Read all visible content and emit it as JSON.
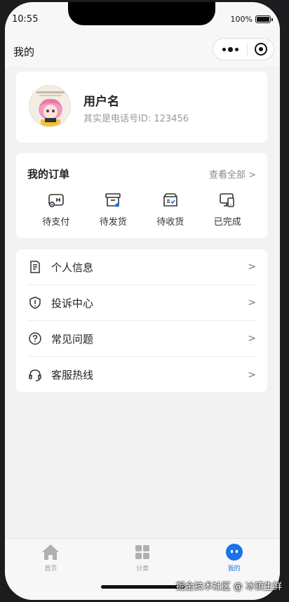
{
  "status_bar": {
    "time": "10:55",
    "battery": "100%"
  },
  "nav": {
    "title": "我的"
  },
  "user": {
    "name": "用户名",
    "subtitle": "其实是电话号ID: 123456"
  },
  "orders": {
    "title": "我的订单",
    "view_all": "查看全部 >",
    "items": [
      {
        "label": "待支付",
        "icon": "wallet-icon"
      },
      {
        "label": "待发货",
        "icon": "box-icon"
      },
      {
        "label": "待收货",
        "icon": "receive-box-icon"
      },
      {
        "label": "已完成",
        "icon": "devices-icon"
      }
    ]
  },
  "menu": {
    "items": [
      {
        "label": "个人信息",
        "icon": "document-icon"
      },
      {
        "label": "投诉中心",
        "icon": "shield-icon"
      },
      {
        "label": "常见问题",
        "icon": "question-icon"
      },
      {
        "label": "客服热线",
        "icon": "headset-icon"
      }
    ],
    "arrow": ">"
  },
  "tabs": [
    {
      "label": "首页",
      "icon": "home-icon",
      "active": false
    },
    {
      "label": "分类",
      "icon": "grid-icon",
      "active": false
    },
    {
      "label": "我的",
      "icon": "profile-icon",
      "active": true
    }
  ],
  "colors": {
    "accent": "#1a73e8",
    "background": "#f2f2f2"
  },
  "watermark": "掘金技术社区 @ 冰镇生鲜"
}
